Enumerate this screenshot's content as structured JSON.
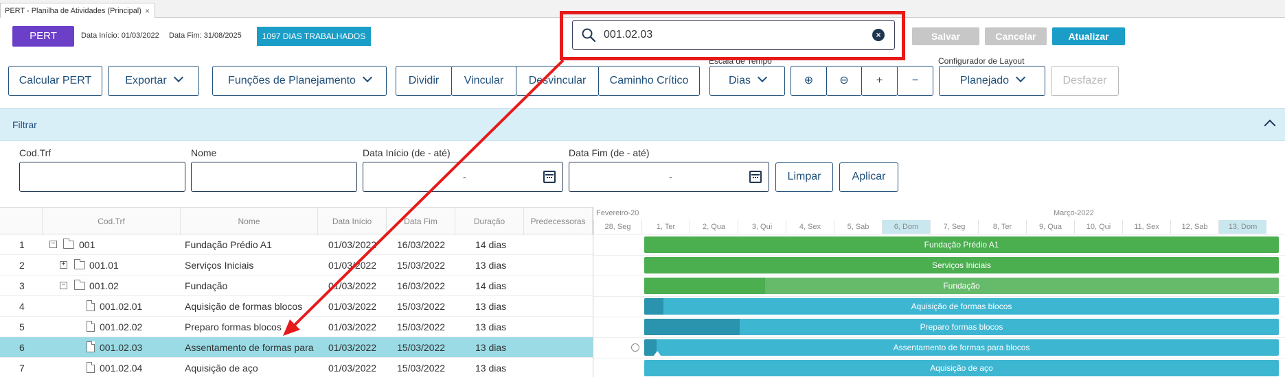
{
  "tab": {
    "title": "PERT - Planilha de Atividades (Principal)",
    "close": "×"
  },
  "header": {
    "pert_button": "PERT",
    "data_inicio": "Data Início: 01/03/2022",
    "data_fim": "Data Fim: 31/08/2025",
    "dias_badge": "1097 DIAS TRABALHADOS",
    "search_value": "001.02.03",
    "salvar": "Salvar",
    "cancelar": "Cancelar",
    "atualizar": "Atualizar"
  },
  "toolbar": {
    "calcular": "Calcular PERT",
    "exportar": "Exportar",
    "funcoes": "Funções de Planejamento",
    "dividir": "Dividir",
    "vincular": "Vincular",
    "desvincular": "Desvincular",
    "caminho": "Caminho Crítico",
    "escala_label": "Escala de Tempo",
    "escala_value": "Dias",
    "zoom_in": "⊕",
    "zoom_out": "⊖",
    "plus": "+",
    "minus": "−",
    "config_label": "Configurador de Layout",
    "config_value": "Planejado",
    "desfazer": "Desfazer"
  },
  "filter": {
    "title": "Filtrar",
    "cod_label": "Cod.Trf",
    "nome_label": "Nome",
    "data_inicio_label": "Data Início (de - até)",
    "data_fim_label": "Data Fim (de - até)",
    "range_dash": "-",
    "limpar": "Limpar",
    "aplicar": "Aplicar"
  },
  "grid": {
    "columns": [
      "Cod.Trf",
      "Nome",
      "Data Início",
      "Data Fim",
      "Duração",
      "Predecessoras"
    ],
    "rows": [
      {
        "n": "1",
        "cod": "001",
        "nome": "Fundação Prédio A1",
        "ini": "01/03/2022",
        "fim": "16/03/2022",
        "dur": "14 dias"
      },
      {
        "n": "2",
        "cod": "001.01",
        "nome": "Serviços Iniciais",
        "ini": "01/03/2022",
        "fim": "15/03/2022",
        "dur": "13 dias"
      },
      {
        "n": "3",
        "cod": "001.02",
        "nome": "Fundação",
        "ini": "01/03/2022",
        "fim": "16/03/2022",
        "dur": "14 dias"
      },
      {
        "n": "4",
        "cod": "001.02.01",
        "nome": "Aquisição de formas blocos",
        "ini": "01/03/2022",
        "fim": "15/03/2022",
        "dur": "13 dias"
      },
      {
        "n": "5",
        "cod": "001.02.02",
        "nome": "Preparo formas blocos",
        "ini": "01/03/2022",
        "fim": "15/03/2022",
        "dur": "13 dias"
      },
      {
        "n": "6",
        "cod": "001.02.03",
        "nome": "Assentamento de formas para blocos",
        "ini": "01/03/2022",
        "fim": "15/03/2022",
        "dur": "13 dias"
      },
      {
        "n": "7",
        "cod": "001.02.04",
        "nome": "Aquisição de aço",
        "ini": "01/03/2022",
        "fim": "15/03/2022",
        "dur": "13 dias"
      }
    ]
  },
  "gantt": {
    "month_feb": "Fevereiro-20",
    "month_mar": "Março-2022",
    "days": [
      "28, Seg",
      "1, Ter",
      "2, Qua",
      "3, Qui",
      "4, Sex",
      "5, Sab",
      "6, Dom",
      "7, Seg",
      "8, Ter",
      "9, Qua",
      "10, Qui",
      "11, Sex",
      "12, Sab",
      "13, Dom"
    ],
    "bars": [
      {
        "label": "Fundação Prédio A1",
        "progress": 0
      },
      {
        "label": "Serviços Iniciais",
        "progress": 0
      },
      {
        "label": "Fundação",
        "progress": 0.19
      },
      {
        "label": "Aquisição de formas blocos",
        "progress": 0.03
      },
      {
        "label": "Preparo formas blocos",
        "progress": 0.15
      },
      {
        "label": "Assentamento de formas para blocos",
        "progress": 0.02
      },
      {
        "label": "Aquisição de aço",
        "progress": 0
      }
    ],
    "colors": {
      "green": "#4bae4f",
      "green_light": "#66bb6a",
      "teal": "#3db6d2",
      "teal_dark": "#2a93ad"
    }
  }
}
